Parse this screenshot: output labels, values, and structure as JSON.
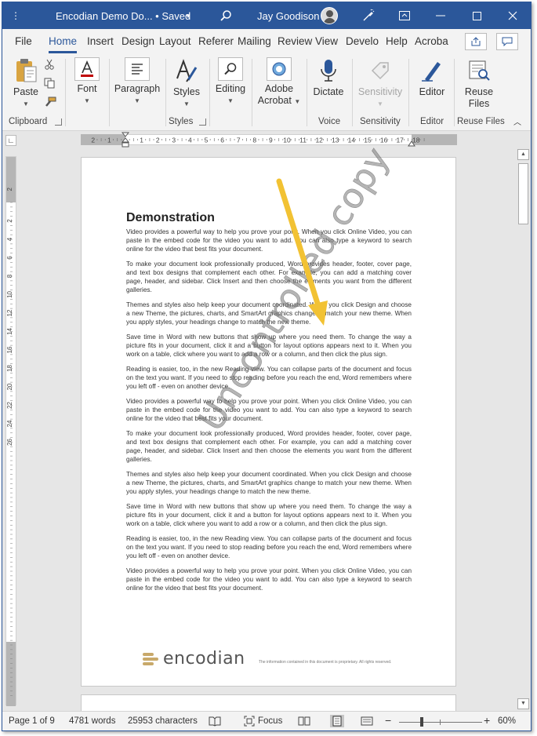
{
  "titlebar": {
    "doc_title": "Encodian Demo Do... • Saved",
    "user_name": "Jay Goodison"
  },
  "tabs": [
    {
      "label": "File"
    },
    {
      "label": "Home"
    },
    {
      "label": "Insert"
    },
    {
      "label": "Design"
    },
    {
      "label": "Layout"
    },
    {
      "label": "Referer"
    },
    {
      "label": "Mailing"
    },
    {
      "label": "Review"
    },
    {
      "label": "View"
    },
    {
      "label": "Develo"
    },
    {
      "label": "Help"
    },
    {
      "label": "Acroba"
    }
  ],
  "ribbon": {
    "paste": "Paste",
    "font": "Font",
    "paragraph": "Paragraph",
    "styles": "Styles",
    "editing": "Editing",
    "adobe_acrobat_1": "Adobe",
    "adobe_acrobat_2": "Acrobat",
    "dictate": "Dictate",
    "sensitivity": "Sensitivity",
    "editor": "Editor",
    "reuse_files_1": "Reuse",
    "reuse_files_2": "Files",
    "groups": {
      "clipboard": "Clipboard",
      "styles": "Styles",
      "voice": "Voice",
      "sensitivity": "Sensitivity",
      "editor": "Editor",
      "reuse_files": "Reuse Files"
    }
  },
  "ruler": {
    "h_labels": [
      "2",
      "1",
      "1",
      "2",
      "3",
      "4",
      "5",
      "6",
      "7",
      "8",
      "9",
      "10",
      "11",
      "12",
      "13",
      "14",
      "15",
      "16",
      "17",
      "18"
    ],
    "v_labels": [
      "2",
      "2",
      "4",
      "6",
      "8",
      "10",
      "12",
      "14",
      "16",
      "18",
      "20",
      "22",
      "24",
      "26"
    ]
  },
  "document": {
    "heading": "Demonstration",
    "paragraphs": [
      "Video provides a powerful way to help you prove your point. When you click Online Video, you can paste in the embed code for the video you want to add. You can also type a keyword to search online for the video that best fits your document.",
      "To make your document look professionally produced, Word provides header, footer, cover page, and text box designs that complement each other. For example, you can add a matching cover page, header, and sidebar. Click Insert and then choose the elements you want from the different galleries.",
      "Themes and styles also help keep your document coordinated. When you click Design and choose a new Theme, the pictures, charts, and SmartArt graphics change to match your new theme. When you apply styles, your headings change to match the new theme.",
      "Save time in Word with new buttons that show up where you need them. To change the way a picture fits in your document, click it and a button for layout options appears next to it. When you work on a table, click where you want to add a row or a column, and then click the plus sign.",
      "Reading is easier, too, in the new Reading view. You can collapse parts of the document and focus on the text you want. If you need to stop reading before you reach the end, Word remembers where you left off - even on another device.",
      "Video provides a powerful way to help you prove your point. When you click Online Video, you can paste in the embed code for the video you want to add. You can also type a keyword to search online for the video that best fits your document.",
      "To make your document look professionally produced, Word provides header, footer, cover page, and text box designs that complement each other. For example, you can add a matching cover page, header, and sidebar. Click Insert and then choose the elements you want from the different galleries.",
      "Themes and styles also help keep your document coordinated. When you click Design and choose a new Theme, the pictures, charts, and SmartArt graphics change to match your new theme. When you apply styles, your headings change to match the new theme.",
      "Save time in Word with new buttons that show up where you need them. To change the way a picture fits in your document, click it and a button for layout options appears next to it. When you work on a table, click where you want to add a row or a column, and then click the plus sign.",
      "Reading is easier, too, in the new Reading view. You can collapse parts of the document and focus on the text you want. If you need to stop reading before you reach the end, Word remembers where you left off - even on another device.",
      "Video provides a powerful way to help you prove your point. When you click Online Video, you can paste in the embed code for the video you want to add. You can also type a keyword to search online for the video that best fits your document."
    ],
    "watermark": "Uncontrolled copy",
    "logo_text": "encodian",
    "footer_note": "The information contained in this document is proprietary. All rights reserved."
  },
  "statusbar": {
    "page": "Page 1 of 9",
    "words": "4781 words",
    "characters": "25953 characters",
    "focus": "Focus",
    "zoom": "60%",
    "zoom_minus": "−",
    "zoom_plus": "+",
    "zoom_level_percent": 60
  },
  "colors": {
    "accent": "#2b579a",
    "arrow": "#f2c233",
    "logo_mark": "#c8a96a"
  }
}
